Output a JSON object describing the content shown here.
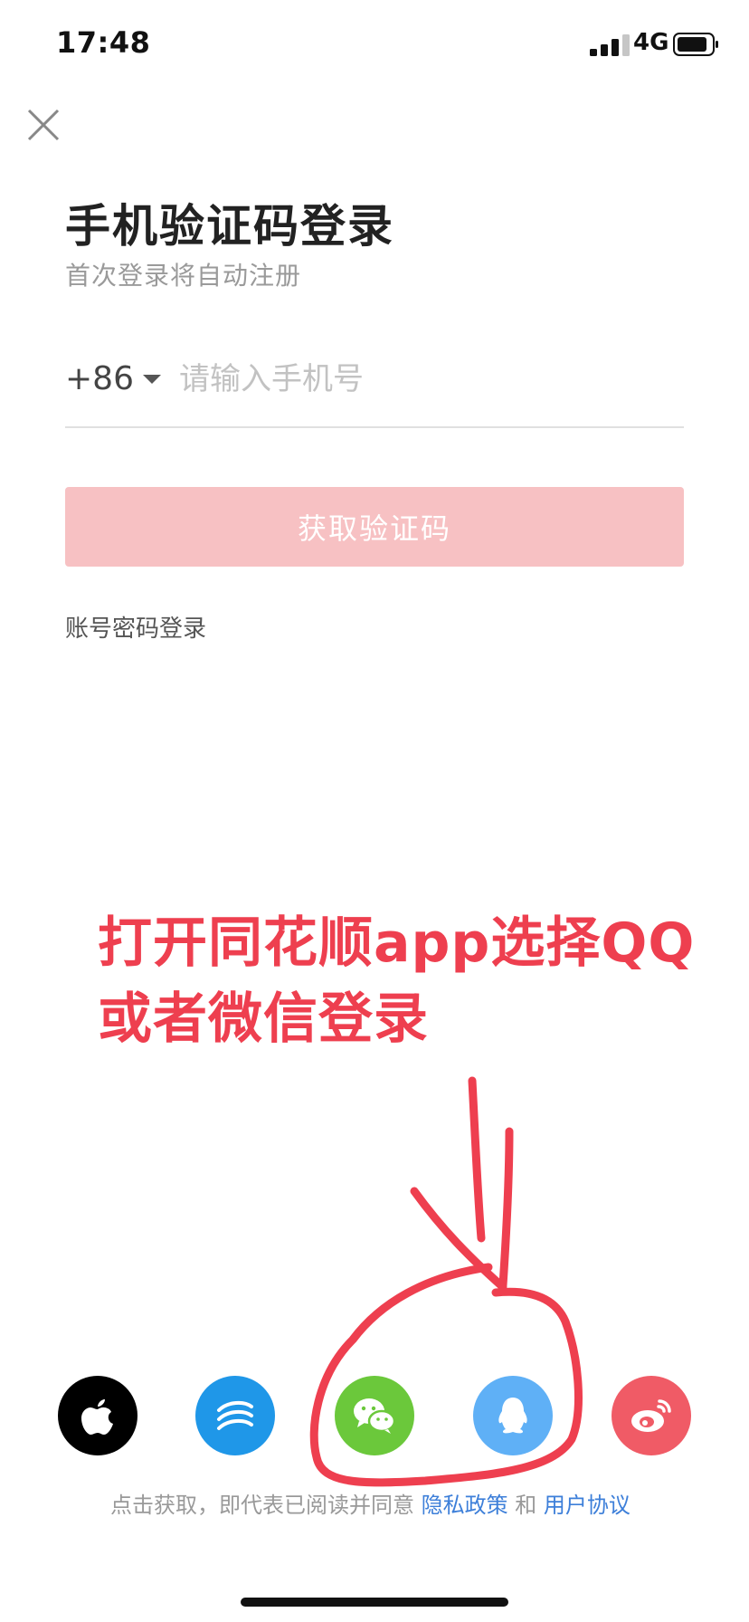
{
  "status_bar": {
    "time": "17:48",
    "network": "4G"
  },
  "header": {
    "title": "手机验证码登录",
    "subtitle": "首次登录将自动注册"
  },
  "phone": {
    "country_code": "+86",
    "placeholder": "请输入手机号",
    "value": ""
  },
  "get_code_button": "获取验证码",
  "password_login_link": "账号密码登录",
  "annotation": {
    "line1": "打开同花顺app选择QQ",
    "line2": "或者微信登录"
  },
  "third_party": [
    {
      "name": "apple",
      "icon": "apple-icon",
      "color": "#000000"
    },
    {
      "name": "china-mobile",
      "icon": "china-mobile-icon",
      "color": "#1f97e8"
    },
    {
      "name": "wechat",
      "icon": "wechat-icon",
      "color": "#6bc83b"
    },
    {
      "name": "qq",
      "icon": "qq-icon",
      "color": "#5fb0f6"
    },
    {
      "name": "weibo",
      "icon": "weibo-icon",
      "color": "#f05b66"
    }
  ],
  "agreement": {
    "prefix": "点击获取，即代表已阅读并同意",
    "privacy": "隐私政策",
    "and": "和",
    "terms": "用户协议"
  },
  "colors": {
    "accent_disabled": "#f7c1c3",
    "annotation_red": "#ee3f4f",
    "link_blue": "#3d7fd9"
  }
}
